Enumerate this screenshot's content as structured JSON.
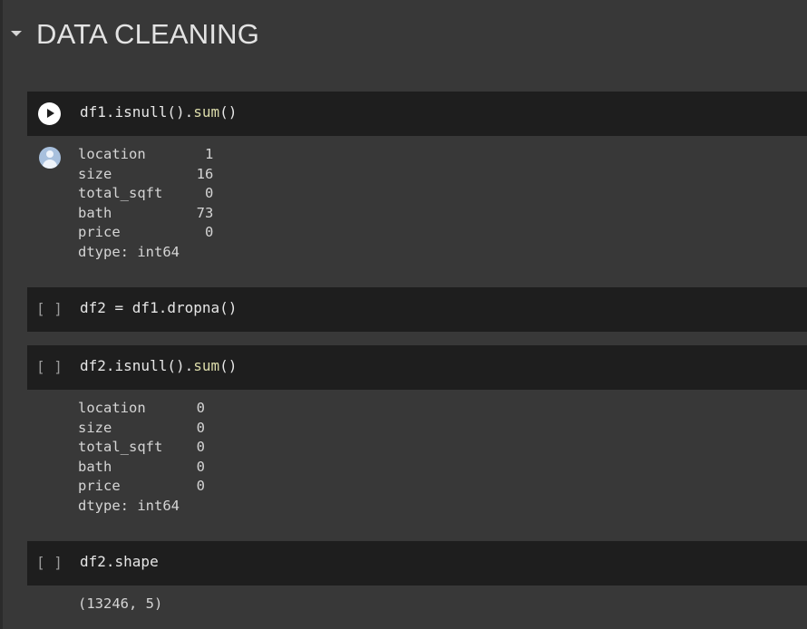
{
  "section": {
    "title": "DATA CLEANING"
  },
  "cells": [
    {
      "exec_label": "",
      "code": [
        {
          "text": "df1.isnull().",
          "cls": ""
        },
        {
          "text": "sum",
          "cls": "fn"
        },
        {
          "text": "()",
          "cls": ""
        }
      ],
      "output": "location       1\nsize          16\ntotal_sqft     0\nbath          73\nprice          0\ndtype: int64"
    },
    {
      "exec_label": "[ ]",
      "code": [
        {
          "text": "df2 = df1.dropna()",
          "cls": ""
        }
      ],
      "output": ""
    },
    {
      "exec_label": "[ ]",
      "code": [
        {
          "text": "df2.isnull().",
          "cls": ""
        },
        {
          "text": "sum",
          "cls": "fn"
        },
        {
          "text": "()",
          "cls": ""
        }
      ],
      "output": "location      0\nsize          0\ntotal_sqft    0\nbath          0\nprice         0\ndtype: int64"
    },
    {
      "exec_label": "[ ]",
      "code": [
        {
          "text": "df2.shape",
          "cls": ""
        }
      ],
      "output": "(13246, 5)"
    }
  ]
}
